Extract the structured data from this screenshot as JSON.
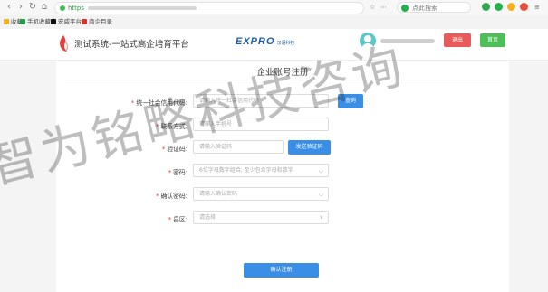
{
  "browser": {
    "url_scheme": "https",
    "search_box": "点此搜索",
    "bookmarks": [
      {
        "label": "收藏",
        "color": "#f2b01e"
      },
      {
        "label": "手机收藏夹",
        "color": "#1aa34a"
      },
      {
        "label": "宏威平台",
        "color": "#111111"
      },
      {
        "label": "商企目录",
        "color": "#d9342b"
      }
    ]
  },
  "header": {
    "site_title": "测试系统-一站式高企培育平台",
    "partner_logo": "EXPRO",
    "partner_logo_sub": "汉语科技",
    "logout_label": "退出",
    "home_label": "首页"
  },
  "form": {
    "title": "企业账号注册",
    "fields": [
      {
        "label": "统一社会信用代码:",
        "required": true,
        "placeholder": "请输入统一社会信用代码"
      },
      {
        "label": "联系方式:",
        "required": true,
        "placeholder": "请输入手机号"
      },
      {
        "label": "验证码:",
        "required": true,
        "placeholder": "请输入验证码"
      },
      {
        "label": "密码:",
        "required": true,
        "placeholder": "6位字母数字组合, 至少包含字母和数字"
      },
      {
        "label": "确认密码:",
        "required": true,
        "placeholder": "请输入确认密码"
      },
      {
        "label": "县区:",
        "required": true,
        "placeholder": "请选择"
      }
    ],
    "query_button": "查询",
    "sms_button": "发送验证码",
    "submit_button": "确认注册"
  },
  "watermark": "智为铭略科技咨询"
}
